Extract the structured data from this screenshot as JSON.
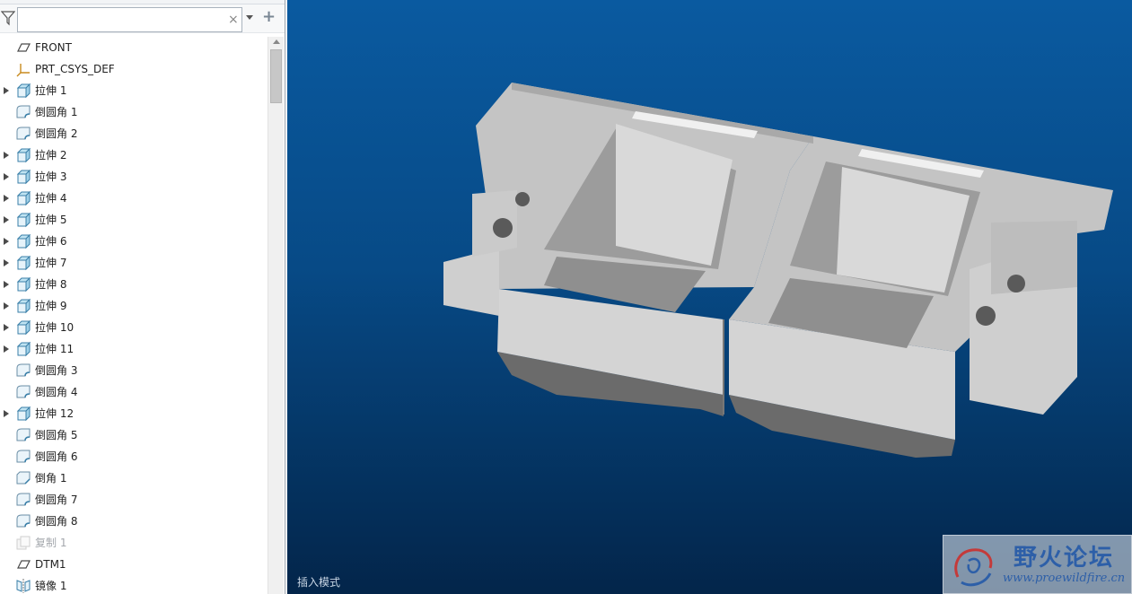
{
  "filter": {
    "search_value": "",
    "search_placeholder": ""
  },
  "tree": {
    "items": [
      {
        "label": "FRONT",
        "icon": "datum-plane-icon",
        "expandable": false
      },
      {
        "label": "PRT_CSYS_DEF",
        "icon": "csys-icon",
        "expandable": false
      },
      {
        "label": "拉伸 1",
        "icon": "extrude-icon",
        "expandable": true
      },
      {
        "label": "倒圆角 1",
        "icon": "round-icon",
        "expandable": false
      },
      {
        "label": "倒圆角 2",
        "icon": "round-icon",
        "expandable": false
      },
      {
        "label": "拉伸 2",
        "icon": "extrude-icon",
        "expandable": true
      },
      {
        "label": "拉伸 3",
        "icon": "extrude-icon",
        "expandable": true
      },
      {
        "label": "拉伸 4",
        "icon": "extrude-icon",
        "expandable": true
      },
      {
        "label": "拉伸 5",
        "icon": "extrude-icon",
        "expandable": true
      },
      {
        "label": "拉伸 6",
        "icon": "extrude-icon",
        "expandable": true
      },
      {
        "label": "拉伸 7",
        "icon": "extrude-icon",
        "expandable": true
      },
      {
        "label": "拉伸 8",
        "icon": "extrude-icon",
        "expandable": true
      },
      {
        "label": "拉伸 9",
        "icon": "extrude-icon",
        "expandable": true
      },
      {
        "label": "拉伸 10",
        "icon": "extrude-icon",
        "expandable": true
      },
      {
        "label": "拉伸 11",
        "icon": "extrude-icon",
        "expandable": true
      },
      {
        "label": "倒圆角 3",
        "icon": "round-icon",
        "expandable": false
      },
      {
        "label": "倒圆角 4",
        "icon": "round-icon",
        "expandable": false
      },
      {
        "label": "拉伸 12",
        "icon": "extrude-icon",
        "expandable": true
      },
      {
        "label": "倒圆角 5",
        "icon": "round-icon",
        "expandable": false
      },
      {
        "label": "倒圆角 6",
        "icon": "round-icon",
        "expandable": false
      },
      {
        "label": "倒角 1",
        "icon": "chamfer-icon",
        "expandable": false
      },
      {
        "label": "倒圆角 7",
        "icon": "round-icon",
        "expandable": false
      },
      {
        "label": "倒圆角 8",
        "icon": "round-icon",
        "expandable": false
      },
      {
        "label": "复制 1",
        "icon": "copy-icon",
        "expandable": false,
        "muted": true
      },
      {
        "label": "DTM1",
        "icon": "datum-plane-icon",
        "expandable": false
      },
      {
        "label": "镜像 1",
        "icon": "mirror-icon",
        "expandable": false
      }
    ]
  },
  "viewport": {
    "mode_label": "插入模式"
  },
  "watermark": {
    "title": "野火论坛",
    "url": "www.proewildfire.cn"
  },
  "colors": {
    "viewport_top": "#0a5aa0",
    "viewport_bottom": "#03254a",
    "model_top": "#c8c8c8",
    "model_front": "#d6d6d6",
    "model_shadow": "#6e6e6e",
    "model_dark": "#555555"
  }
}
